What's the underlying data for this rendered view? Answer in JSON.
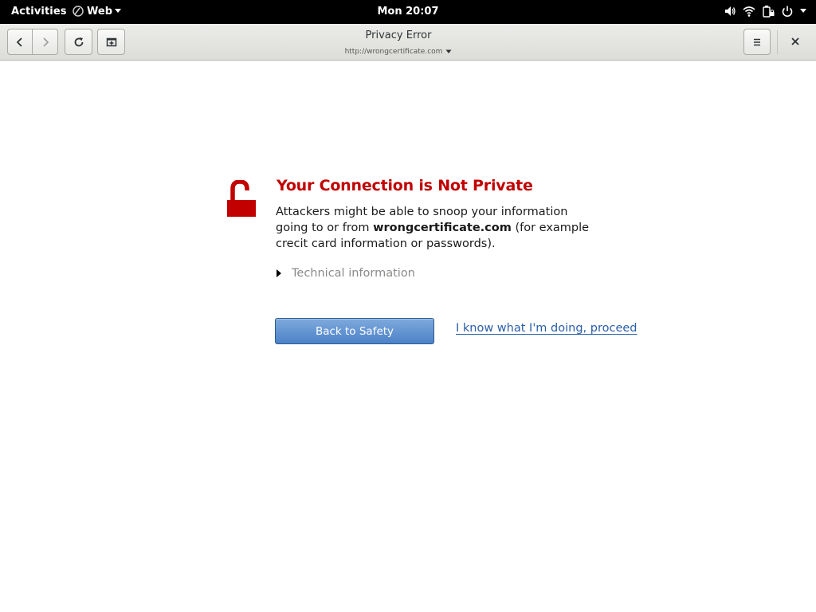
{
  "topbar": {
    "activities_label": "Activities",
    "app_name": "Web",
    "clock": "Mon 20:07"
  },
  "browser": {
    "page_title": "Privacy Error",
    "url": "http://wrongcertificate.com"
  },
  "error_page": {
    "title": "Your Connection is Not Private",
    "desc_before": "Attackers might be able to snoop your information going to or from ",
    "desc_host": "wrongcertificate.com",
    "desc_after": " (for example crecit card information or passwords).",
    "technical_info_label": "Technical information",
    "back_button_label": "Back to Safety",
    "proceed_link_label": "I know what I'm doing, proceed"
  },
  "colors": {
    "error_red": "#c20000",
    "link_blue": "#2a5ea8",
    "button_blue": "#4c82c9"
  }
}
